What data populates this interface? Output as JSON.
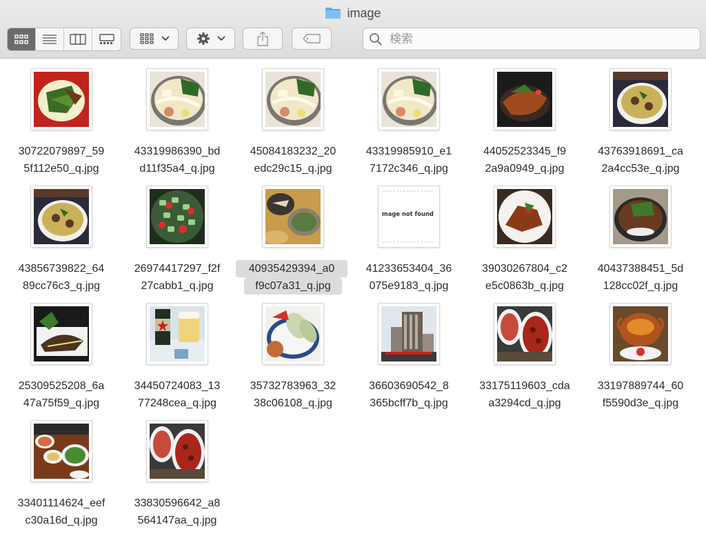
{
  "window": {
    "title": "image"
  },
  "toolbar": {
    "view_modes": [
      "icon-view",
      "list-view",
      "column-view",
      "gallery-view"
    ],
    "active_view": "icon-view",
    "group_by": "group-icon",
    "action": "gear-icon",
    "share": "share-icon",
    "tag": "tag-icon"
  },
  "search": {
    "placeholder": "検索",
    "value": ""
  },
  "files": [
    {
      "line1": "30722079897_59",
      "line2": "5f112e50_q.jpg",
      "thumb": "salad-red",
      "selected": false
    },
    {
      "line1": "43319986390_bd",
      "line2": "d11f35a4_q.jpg",
      "thumb": "noodle-bowl",
      "selected": false
    },
    {
      "line1": "45084183232_20",
      "line2": "edc29c15_q.jpg",
      "thumb": "noodle-bowl",
      "selected": false
    },
    {
      "line1": "43319985910_e1",
      "line2": "7172c346_q.jpg",
      "thumb": "noodle-bowl",
      "selected": false
    },
    {
      "line1": "44052523345_f9",
      "line2": "2a9a0949_q.jpg",
      "thumb": "fried-fish",
      "selected": false
    },
    {
      "line1": "43763918691_ca",
      "line2": "2a4cc53e_q.jpg",
      "thumb": "curry-bowl",
      "selected": false
    },
    {
      "line1": "43856739822_64",
      "line2": "89cc76c3_q.jpg",
      "thumb": "curry-bowl",
      "selected": false
    },
    {
      "line1": "26974417297_f2f",
      "line2": "27cabb1_q.jpg",
      "thumb": "cucumber-salad",
      "selected": false
    },
    {
      "line1": "40935429394_a0",
      "line2": "f9c07a31_q.jpg",
      "thumb": "table-dishes",
      "selected": true
    },
    {
      "line1": "41233653404_36",
      "line2": "075e9183_q.jpg",
      "thumb": "not-found",
      "selected": false
    },
    {
      "line1": "39030267804_c2",
      "line2": "e5c0863b_q.jpg",
      "thumb": "plate-meat",
      "selected": false
    },
    {
      "line1": "40437388451_5d",
      "line2": "128cc02f_q.jpg",
      "thumb": "rice-bowl",
      "selected": false
    },
    {
      "line1": "25309525208_6a",
      "line2": "47a75f59_q.jpg",
      "thumb": "fish-plate",
      "selected": false
    },
    {
      "line1": "34450724083_13",
      "line2": "77248cea_q.jpg",
      "thumb": "beer",
      "selected": false
    },
    {
      "line1": "35732783963_32",
      "line2": "38c06108_q.jpg",
      "thumb": "spring-rolls",
      "selected": false
    },
    {
      "line1": "36603690542_8",
      "line2": "365bcff7b_q.jpg",
      "thumb": "building",
      "selected": false
    },
    {
      "line1": "33175119603_cda",
      "line2": "a3294cd_q.jpg",
      "thumb": "red-dishes",
      "selected": false
    },
    {
      "line1": "33197889744_60",
      "line2": "f5590d3e_q.jpg",
      "thumb": "clay-pot",
      "selected": false
    },
    {
      "line1": "33401114624_eef",
      "line2": "c30a16d_q.jpg",
      "thumb": "table-spread",
      "selected": false
    },
    {
      "line1": "33830596642_a8",
      "line2": "564147aa_q.jpg",
      "thumb": "red-dishes",
      "selected": false
    }
  ],
  "not_found_text": "mage not found",
  "colors": {
    "folder": "#5aa9f0",
    "selection": "#dcdcdc",
    "active_segment": "#6b6b6b"
  }
}
